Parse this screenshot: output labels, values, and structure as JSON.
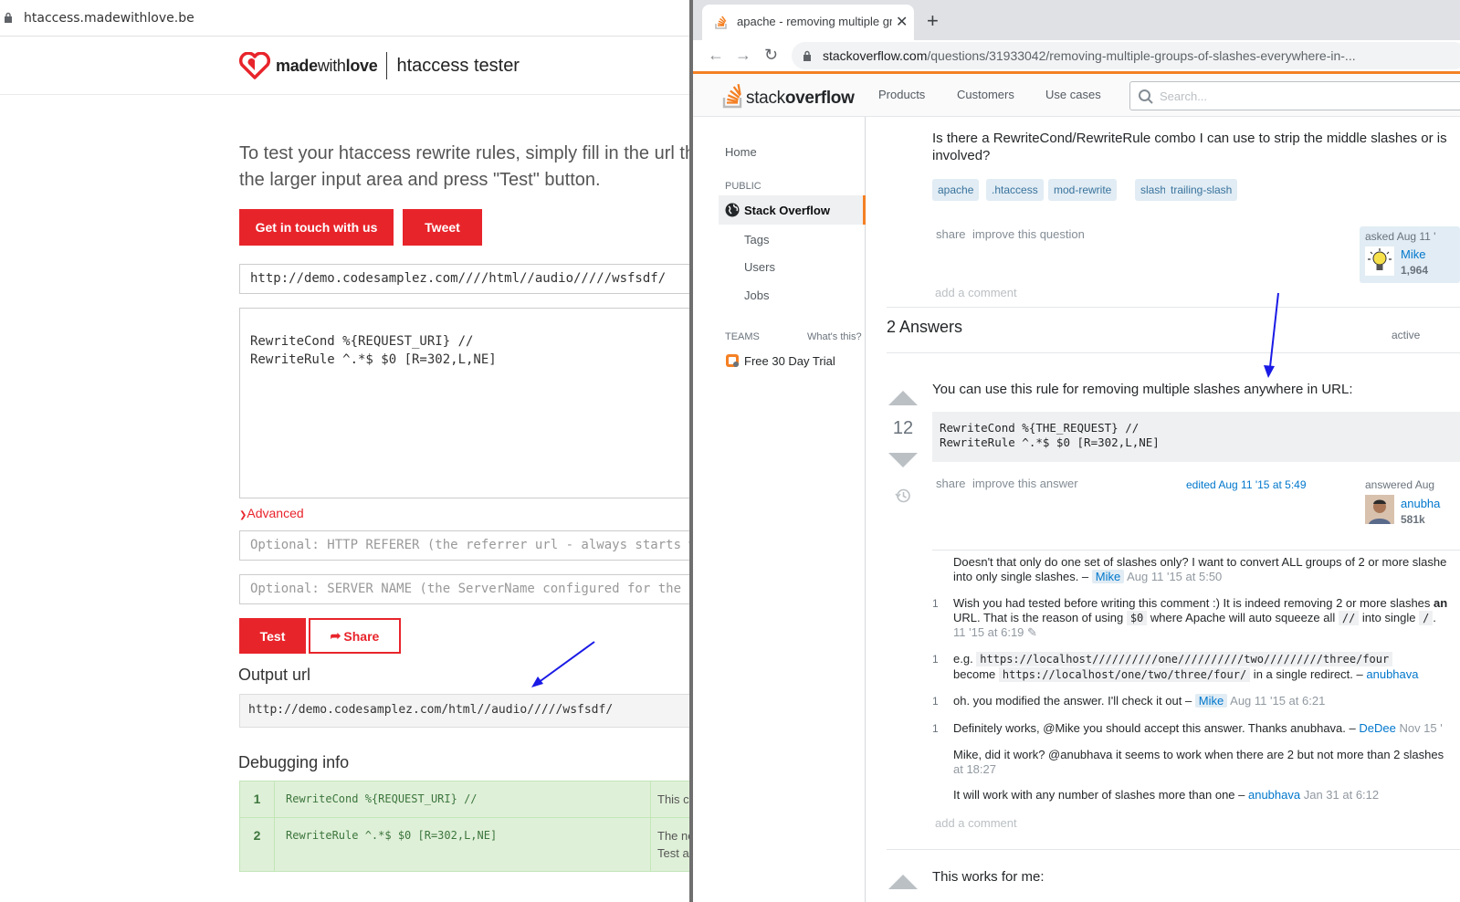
{
  "left": {
    "address_bar": {
      "url": "htaccess.madewithlove.be"
    },
    "header": {
      "brand_bold": "made",
      "brand_bold2": "with",
      "brand_rest": "love",
      "title": "htaccess tester"
    },
    "intro": {
      "line1": "To test your htaccess rewrite rules, simply fill in the url tha",
      "line2": "the larger input area and press \"Test\" button."
    },
    "buttons": {
      "contact": "Get in touch with us",
      "tweet": "Tweet",
      "test": "Test",
      "share": "Share"
    },
    "url_input": "http://demo.codesamplez.com////html//audio/////wsfsdf/",
    "rules": "RewriteCond %{REQUEST_URI} //\nRewriteRule ^.*$ $0 [R=302,L,NE]",
    "advanced_label": "Advanced",
    "referer_placeholder": "Optional: HTTP REFERER (the referrer url - always starts w",
    "server_placeholder": "Optional: SERVER NAME (the ServerName configured for the v",
    "output_heading": "Output url",
    "output_url": "http://demo.codesamplez.com/html//audio/////wsfsdf/",
    "debug_heading": "Debugging info",
    "debug_rows": [
      {
        "num": "1",
        "rule": "RewriteCond %{REQUEST_URI} //",
        "msg1": "This c",
        "msg2": ""
      },
      {
        "num": "2",
        "rule": "RewriteRule ^.*$ $0 [R=302,L,NE]",
        "msg1": "The ne",
        "msg2": "Test a"
      }
    ]
  },
  "right": {
    "tab": {
      "title": "apache - removing multiple gro"
    },
    "omnibox": {
      "host": "stackoverflow.com",
      "path": "/questions/31933042/removing-multiple-groups-of-slashes-everywhere-in-..."
    },
    "so_nav": {
      "products": "Products",
      "customers": "Customers",
      "use_cases": "Use cases",
      "search_placeholder": "Search..."
    },
    "logo": {
      "word1": "stack",
      "word2": "overflow"
    },
    "left_nav": {
      "home": "Home",
      "public": "PUBLIC",
      "stack_overflow": "Stack Overflow",
      "tags": "Tags",
      "users": "Users",
      "jobs": "Jobs",
      "teams": "TEAMS",
      "whats_this": "What's this?",
      "trial": "Free 30 Day Trial"
    },
    "question": {
      "text_line1": "Is there a RewriteCond/RewriteRule combo I can use to strip the middle slashes or is",
      "text_line2": "involved?",
      "tags": [
        "apache",
        ".htaccess",
        "mod-rewrite",
        "slash",
        "trailing-slash"
      ],
      "share": "share",
      "improve": "improve this question",
      "asked": "asked Aug 11 '",
      "owner": "Mike",
      "owner_rep": "1,964",
      "add_comment": "add a comment"
    },
    "answers_heading": "2 Answers",
    "sort_active": "active",
    "answer": {
      "votes": "12",
      "text": "You can use this rule for removing multiple slashes anywhere in URL:",
      "code": "RewriteCond %{THE_REQUEST} //\nRewriteRule ^.*$ $0 [R=302,L,NE]",
      "share": "share",
      "improve": "improve this answer",
      "edited": "edited Aug 11 '15 at 5:49",
      "answered": "answered Aug",
      "author": "anubha",
      "author_rep": "581k",
      "add_comment": "add a comment"
    },
    "comments": [
      {
        "score": "",
        "l1": "Doesn't that only do one set of slashes only? I want to convert ALL groups of 2 or more slashe",
        "l2": "into only single slashes. – ",
        "user": "Mike",
        "date": "Aug 11 '15 at 5:50"
      },
      {
        "score": "1",
        "l1a": "Wish you had tested before writing this comment :) It is indeed removing 2 or more slashes ",
        "l1b": "an",
        "l2a": "URL. That is the reason of using ",
        "c1": "$0",
        "l2b": " where Apache will auto squeeze all ",
        "c2": "//",
        "l2c": " into single ",
        "c3": "/",
        "l2d": ".",
        "l3": "11 '15 at 6:19"
      },
      {
        "score": "1",
        "l1a": "e.g. ",
        "c1": "https://localhost//////////one//////////two/////////three/four",
        "l2a": "become ",
        "c2": "https://localhost/one/two/three/four/",
        "l2b": " in a single redirect. – ",
        "user": "anubhava"
      },
      {
        "score": "1",
        "text": "oh. you modified the answer. I'll check it out – ",
        "user": "Mike",
        "date": "Aug 11 '15 at 6:21"
      },
      {
        "score": "1",
        "text": "Definitely works, @Mike you should accept this answer. Thanks anubhava. – ",
        "user": "DeDee",
        "date": "Nov 15 '"
      },
      {
        "score": "",
        "l1": "Mike, did it work? @anubhava it seems to work when there are 2 but not more than 2 slashes",
        "l2": "at 18:27"
      },
      {
        "score": "",
        "text": "It will work with any number of slashes more than one – ",
        "user": "anubhava",
        "date": "Jan 31 at 6:12"
      }
    ],
    "next_answer": "This works for me:"
  }
}
